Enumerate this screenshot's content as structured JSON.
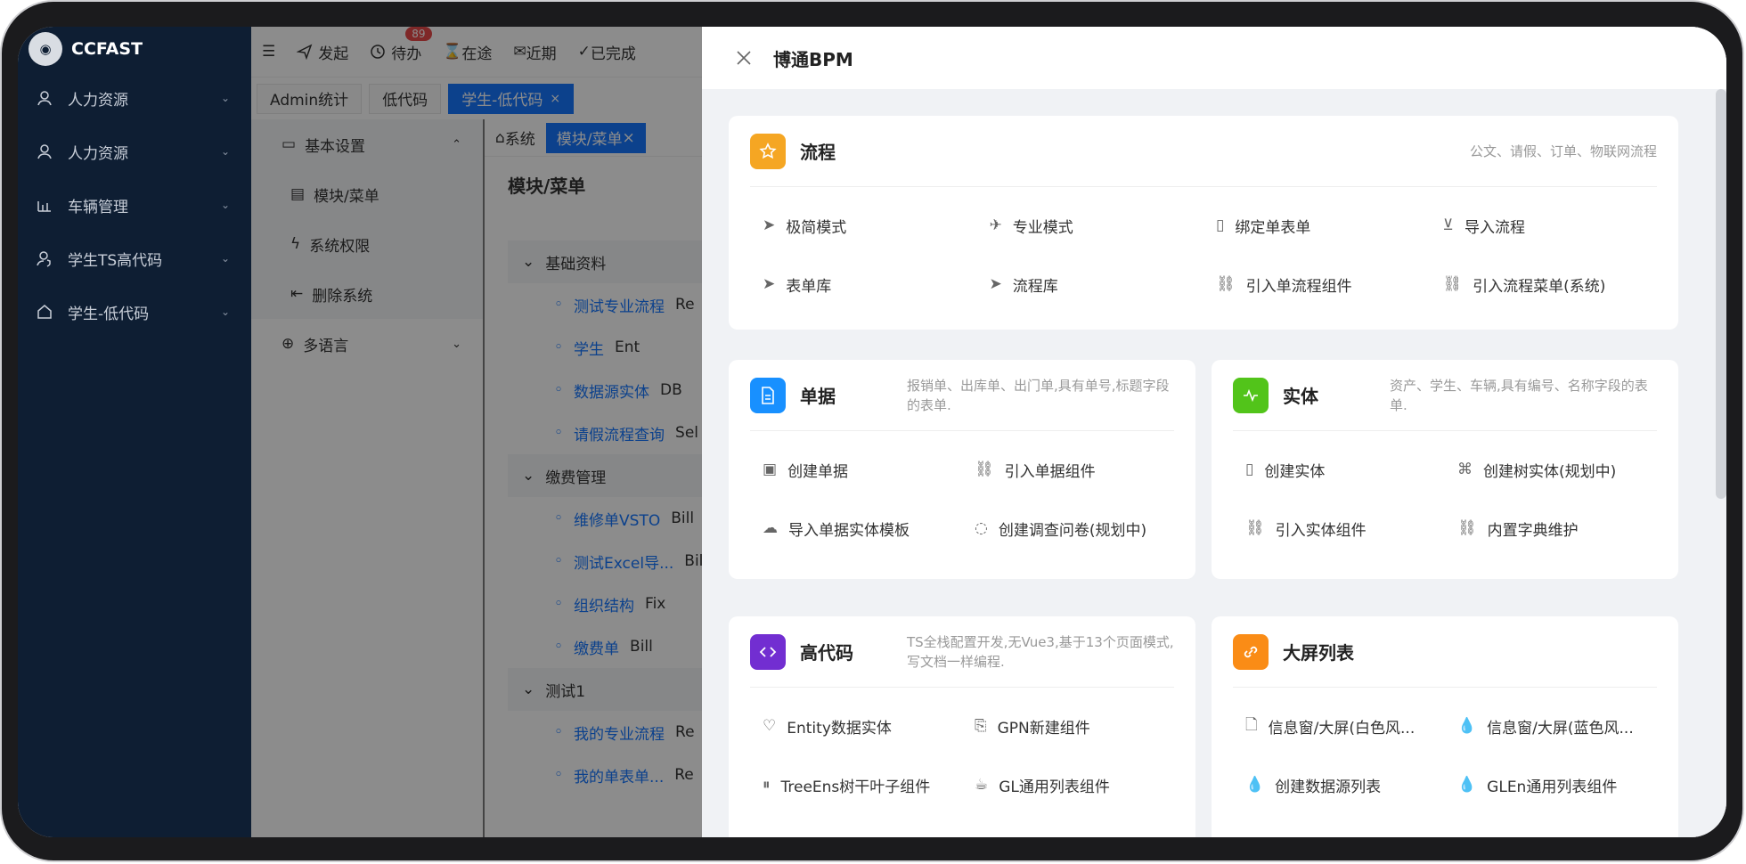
{
  "app": {
    "name": "CCFAST"
  },
  "sidebar": {
    "items": [
      {
        "label": "人力资源",
        "icon": "user-icon"
      },
      {
        "label": "人力资源",
        "icon": "user-icon"
      },
      {
        "label": "车辆管理",
        "icon": "chart-icon"
      },
      {
        "label": "学生TS高代码",
        "icon": "user-shield-icon"
      },
      {
        "label": "学生-低代码",
        "icon": "home-icon"
      }
    ]
  },
  "topbar": {
    "items": [
      "发起",
      "待办",
      "在途",
      "近期",
      "已完成"
    ],
    "todo_badge": "89"
  },
  "tabs": [
    {
      "label": "Admin统计"
    },
    {
      "label": "低代码"
    },
    {
      "label": "学生-低代码",
      "close": "×"
    }
  ],
  "leftpanel": {
    "group1": "基本设置",
    "group1_items": [
      "模块/菜单",
      "系统权限",
      "删除系统"
    ],
    "group2": "多语言"
  },
  "content": {
    "tabs": [
      "系统",
      "模块/菜单"
    ],
    "title": "模块/菜单",
    "tree": [
      {
        "label": "基础资料",
        "group": true
      },
      {
        "label": "测试专业流程",
        "type": "Re"
      },
      {
        "label": "学生",
        "type": "Ent"
      },
      {
        "label": "数据源实体",
        "type": "DB"
      },
      {
        "label": "请假流程查询",
        "type": "Sel"
      },
      {
        "label": "缴费管理",
        "group": true
      },
      {
        "label": "维修单VSTO",
        "type": "Bill"
      },
      {
        "label": "测试Excel导...",
        "type": "Bill"
      },
      {
        "label": "组织结构",
        "type": "Fix"
      },
      {
        "label": "缴费单",
        "type": "Bill"
      },
      {
        "label": "测试1",
        "group": true
      },
      {
        "label": "我的专业流程",
        "type": "Re"
      },
      {
        "label": "我的单表单...",
        "type": "Re"
      }
    ]
  },
  "drawer": {
    "title": "博通BPM",
    "cards": {
      "flow": {
        "title": "流程",
        "desc": "公文、请假、订单、物联网流程",
        "color": "#f5a623",
        "items": [
          "极简模式",
          "专业模式",
          "绑定单表单",
          "导入流程",
          "表单库",
          "流程库",
          "引入单流程组件",
          "引入流程菜单(系统)"
        ]
      },
      "bill": {
        "title": "单据",
        "desc": "报销单、出库单、出门单,具有单号,标题字段的表单.",
        "color": "#1890ff",
        "items": [
          "创建单据",
          "引入单据组件",
          "导入单据实体模板",
          "创建调查问卷(规划中)"
        ]
      },
      "entity": {
        "title": "实体",
        "desc": "资产、学生、车辆,具有编号、名称字段的表单.",
        "color": "#52c41a",
        "items": [
          "创建实体",
          "创建树实体(规划中)",
          "引入实体组件",
          "内置字典维护"
        ]
      },
      "code": {
        "title": "高代码",
        "desc": "TS全栈配置开发,无Vue3,基于13个页面模式,写文档一样编程.",
        "color": "#722ed1",
        "items": [
          "Entity数据实体",
          "GPN新建组件",
          "TreeEns树干叶子组件",
          "GL通用列表组件"
        ]
      },
      "screen": {
        "title": "大屏列表",
        "desc": "",
        "color": "#fa8c16",
        "items": [
          "信息窗/大屏(白色风...",
          "信息窗/大屏(蓝色风...",
          "创建数据源列表",
          "GLEn通用列表组件"
        ]
      }
    }
  }
}
